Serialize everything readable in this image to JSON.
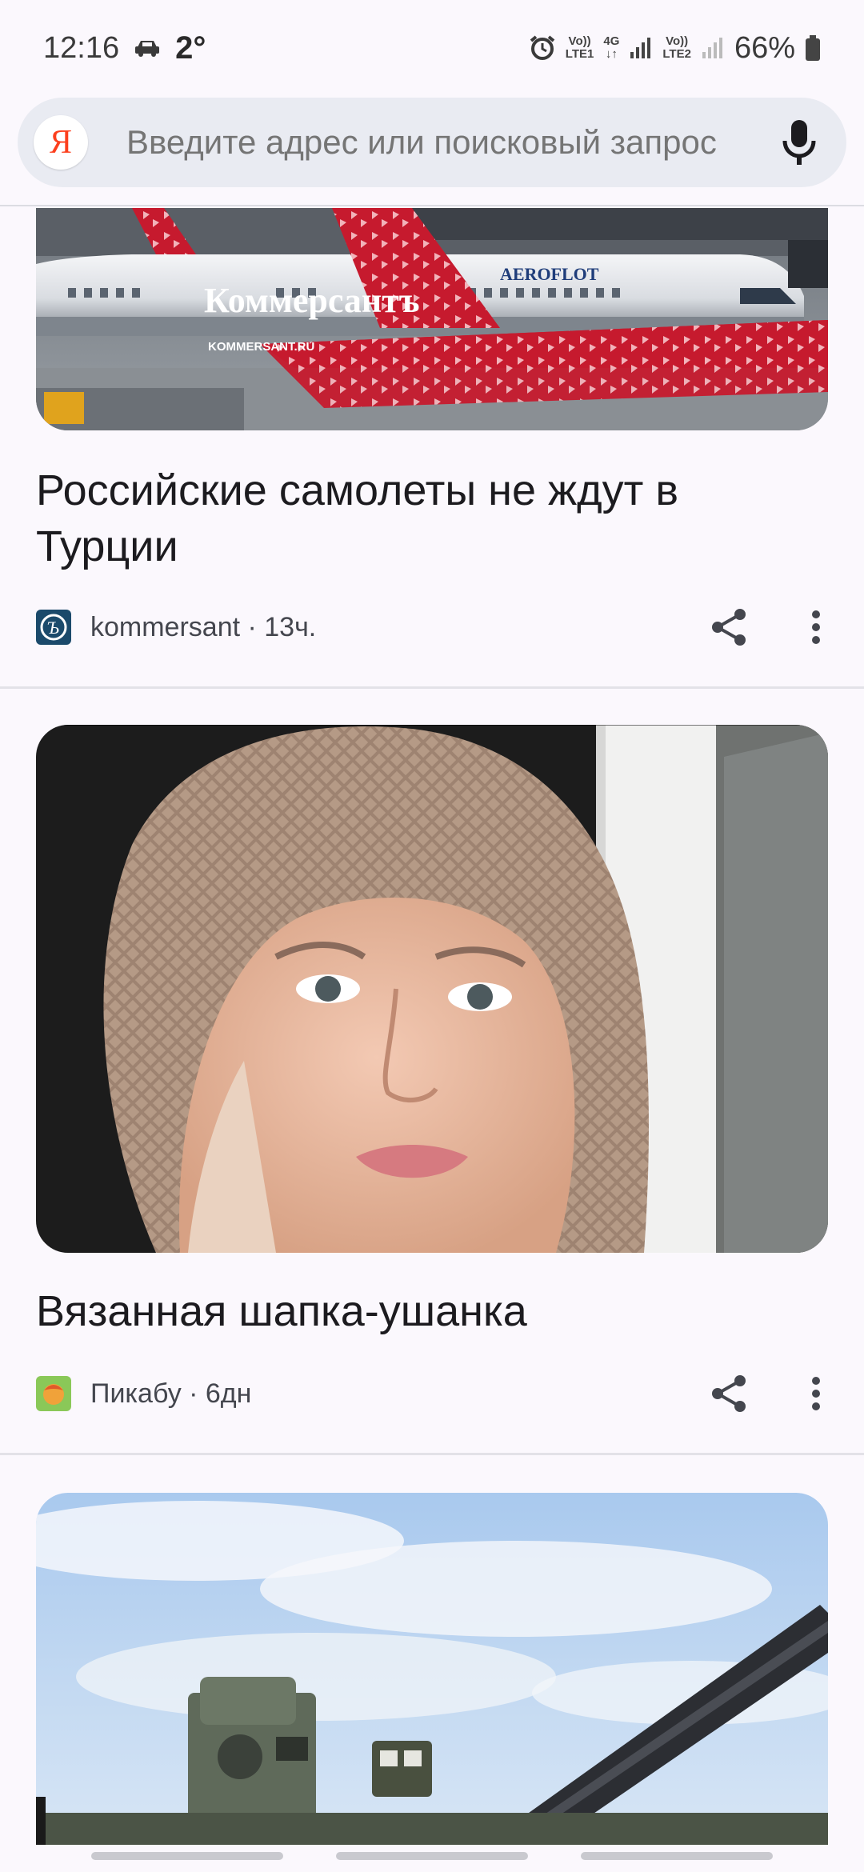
{
  "status": {
    "time": "12:16",
    "temperature": "2°",
    "sim1_top": "Vo))",
    "sim1_bottom": "LTE1",
    "net_top": "4G",
    "net_bottom": "↓↑",
    "sim2_top": "Vo))",
    "sim2_bottom": "LTE2",
    "battery": "66%"
  },
  "search": {
    "logo": "Я",
    "placeholder": "Введите адрес или поисковый запрос",
    "mic_icon": "microphone-icon"
  },
  "feed": [
    {
      "image_caption": "Коммерсантъ",
      "image_sub": "KOMMERSANT.RU",
      "image_airline": "AEROFLOT",
      "title": "Российские самолеты не ждут в Турции",
      "source": "kommersant · 13ч.",
      "source_icon": "kommersant-logo-icon"
    },
    {
      "title": "Вязанная шапка-ушанка",
      "source": "Пикабу · 6дн",
      "source_icon": "pikabu-logo-icon"
    },
    {
      "title": "",
      "source": ""
    }
  ],
  "colors": {
    "background": "#fbf8fd",
    "search_bg": "#e9ebf2",
    "yandex_red": "#fc3f1d",
    "text": "#1c1b1f",
    "meta_text": "#44464e"
  }
}
